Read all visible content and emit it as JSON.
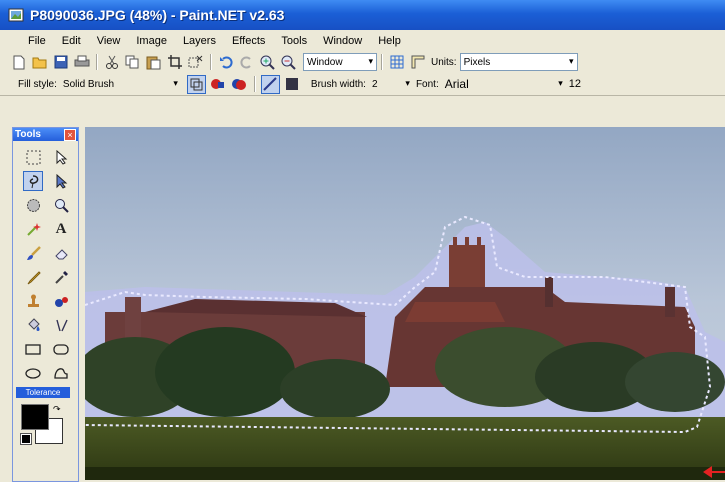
{
  "window": {
    "title": "P8090036.JPG (48%) - Paint.NET v2.63"
  },
  "menu": [
    "File",
    "Edit",
    "View",
    "Image",
    "Layers",
    "Effects",
    "Tools",
    "Window",
    "Help"
  ],
  "toolbar1": {
    "icons": [
      "new-icon",
      "open-icon",
      "save-icon",
      "print-icon",
      "cut-icon",
      "copy-icon",
      "paste-icon",
      "crop-icon",
      "deselect-icon",
      "undo-icon",
      "redo-icon",
      "zoom-in-icon",
      "zoom-out-icon"
    ],
    "zoom_combo": "Window",
    "units_label": "Units:",
    "units_value": "Pixels"
  },
  "toolbar2": {
    "fill_style_label": "Fill style:",
    "fill_style_value": "Solid Brush",
    "brush_width_label": "Brush width:",
    "brush_width_value": "2",
    "font_label": "Font:",
    "font_value": "Arial",
    "font_size": "12"
  },
  "tools": {
    "title": "Tools",
    "close": "×",
    "text_tool": "A",
    "tolerance": "Tolerance",
    "items": [
      "rectangle-select-icon",
      "move-selection-icon",
      "lasso-select-icon",
      "move-selected-icon",
      "ellipse-select-icon",
      "zoom-icon",
      "magic-wand-icon",
      "text-icon",
      "paintbrush-icon",
      "eraser-icon",
      "pencil-icon",
      "color-picker-icon",
      "clone-stamp-icon",
      "recolor-icon",
      "paint-bucket-icon",
      "line-icon",
      "rectangle-icon",
      "rounded-rectangle-icon",
      "ellipse-icon",
      "freeform-shape-icon"
    ],
    "selected_index": 2,
    "primary_color": "#000000",
    "secondary_color": "#ffffff"
  },
  "colors": {
    "titlebar": "#1b5fd6",
    "chrome": "#ece9d8",
    "accent": "#316ac5",
    "annotation": "#e52222"
  }
}
